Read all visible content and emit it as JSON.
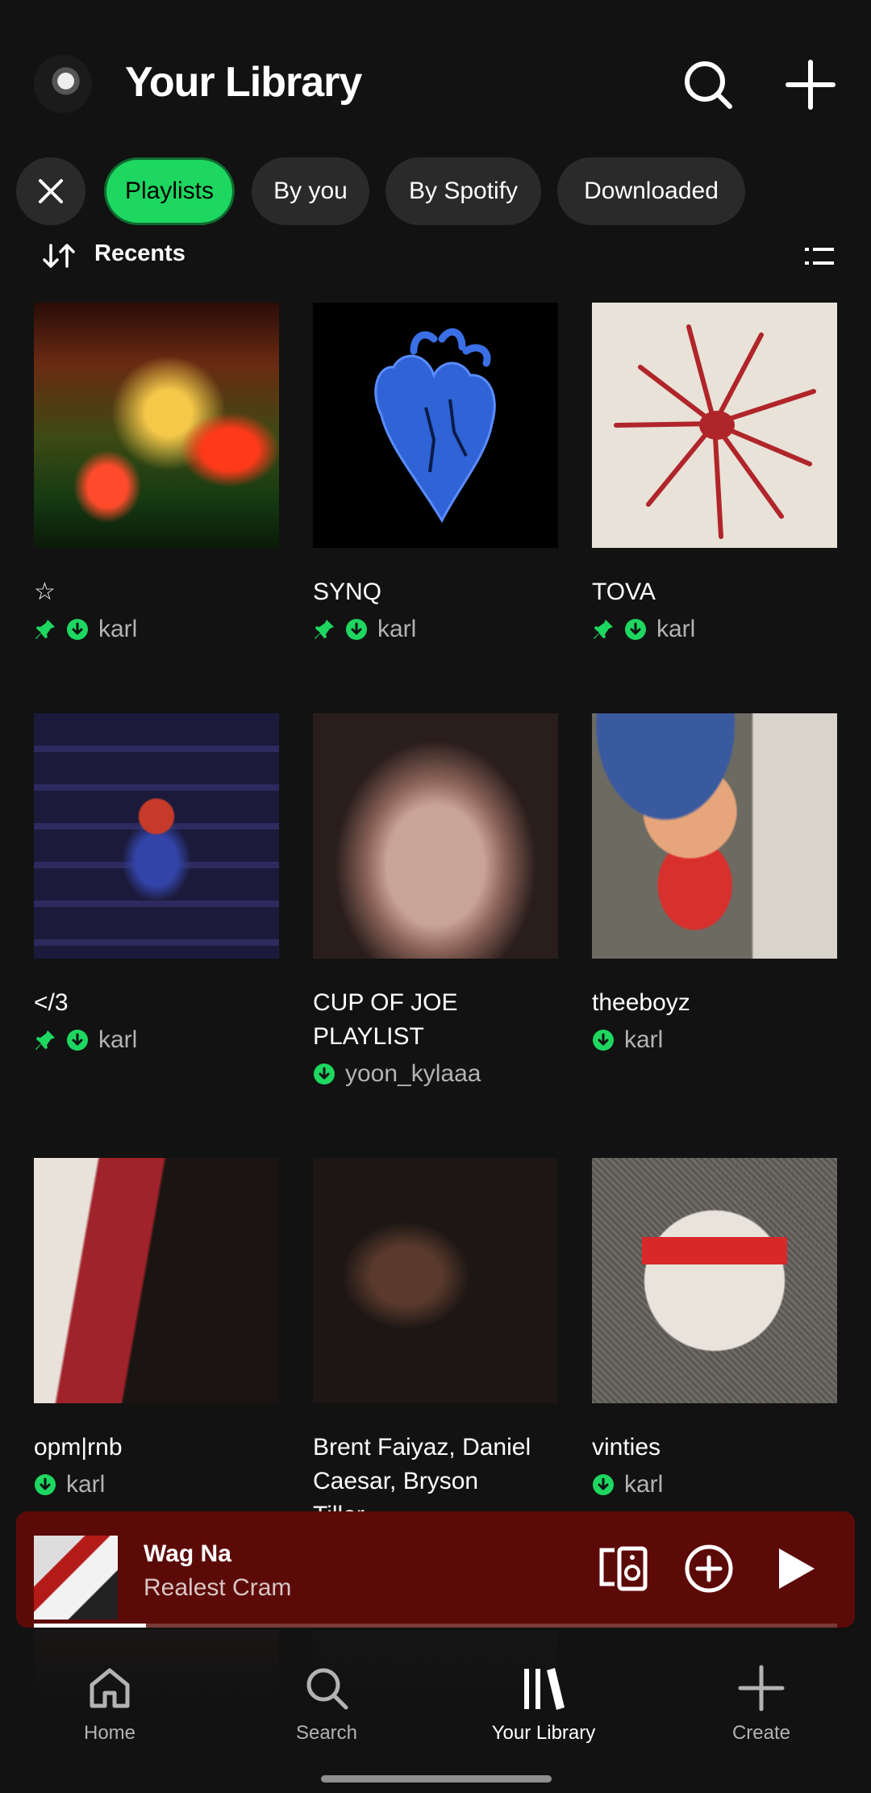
{
  "header": {
    "title": "Your Library",
    "avatar_icon": "profile-avatar",
    "search_icon": "search-icon",
    "add_icon": "plus-icon"
  },
  "filters": {
    "clear_icon": "close-icon",
    "chips": [
      "Playlists",
      "By you",
      "By Spotify",
      "Downloaded"
    ],
    "active": "Playlists",
    "accent": "#1ed760"
  },
  "sort": {
    "label": "Recents",
    "view_icon": "list-view-icon"
  },
  "playlists": [
    {
      "name": "☆",
      "owner": "karl",
      "pinned": true,
      "downloaded": true
    },
    {
      "name": "SYNQ",
      "owner": "karl",
      "pinned": true,
      "downloaded": true
    },
    {
      "name": "TOVA",
      "owner": "karl",
      "pinned": true,
      "downloaded": true
    },
    {
      "name": "</3",
      "owner": "karl",
      "pinned": true,
      "downloaded": true
    },
    {
      "name": "CUP OF JOE PLAYLIST",
      "owner": "yoon_kylaaa",
      "pinned": false,
      "downloaded": true
    },
    {
      "name": "theeboyz",
      "owner": "karl",
      "pinned": false,
      "downloaded": true
    },
    {
      "name": "opm|rnb",
      "owner": "karl",
      "pinned": false,
      "downloaded": true
    },
    {
      "name": "Brent Faiyaz, Daniel Caesar, Bryson Tiller…",
      "owner": "",
      "pinned": false,
      "downloaded": false
    },
    {
      "name": "vinties",
      "owner": "karl",
      "pinned": false,
      "downloaded": true
    }
  ],
  "now_playing": {
    "title": "Wag Na",
    "artist": "Realest Cram",
    "progress": 0.14,
    "background": "#5c0a08"
  },
  "nav": {
    "items": [
      "Home",
      "Search",
      "Your Library",
      "Create"
    ],
    "active": "Your Library"
  }
}
